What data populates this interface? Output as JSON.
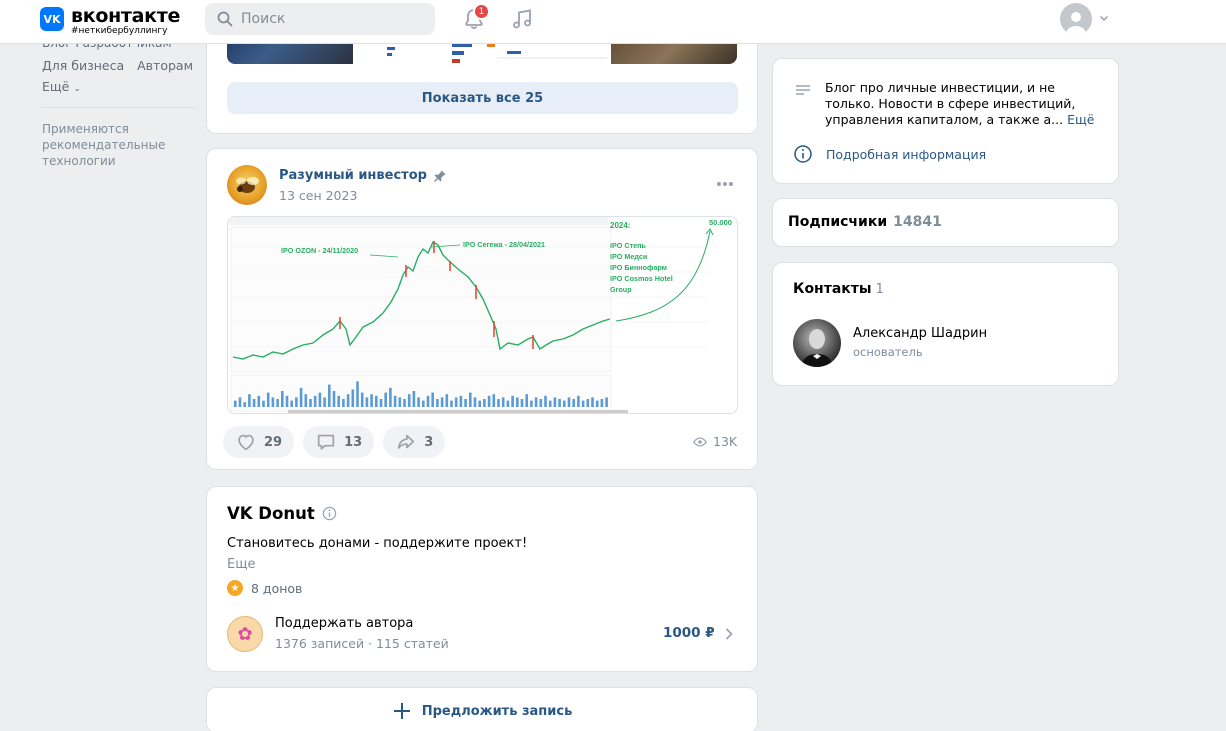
{
  "header": {
    "logo_title": "вконтакте",
    "logo_tag": "#неткибербуллингу",
    "logo_mark": "VK",
    "search_placeholder": "Поиск",
    "notifications_count": "1"
  },
  "leftnav": {
    "row1": "Блог   Разработчикам",
    "items": [
      "Для бизнеса",
      "Авторам"
    ],
    "more": "Ещё",
    "note": "Применяются рекомендательные технологии"
  },
  "photos": {
    "show_all": "Показать все 25"
  },
  "post": {
    "author": "Разумный инвестор",
    "date": "13 сен 2023",
    "chart_labels": {
      "ipo1": "IPO OZON - 24/11/2020",
      "ipo2": "IPO Сегежа - 28/04/2021",
      "year": "2024:",
      "target": "50.000",
      "list": [
        "IPO Степь",
        "IPO Медси",
        "IPO Биннофарм",
        "IPO Cosmos Hotel",
        "Group"
      ]
    },
    "likes": "29",
    "comments": "13",
    "shares": "3",
    "views": "13K"
  },
  "donut": {
    "title": "VK Donut",
    "description": "Становитесь донами - поддержите проект!",
    "more": "Еще",
    "donors": "8 донов",
    "support_title": "Поддержать автора",
    "support_sub": "1376 записей · 115 статей",
    "price": "1000 ₽"
  },
  "suggest": {
    "label": "Предложить запись"
  },
  "about": {
    "text": "Блог про личные инвестиции, и не только. Новости в сфере инвестиций, управления капиталом, а также а...",
    "more_link": "Ещё",
    "info_link": "Подробная информация"
  },
  "subscribers": {
    "label": "Подписчики",
    "count": "14841"
  },
  "contacts": {
    "title": "Контакты",
    "count": "1",
    "name": "Александр Шадрин",
    "role": "основатель"
  },
  "colors": {
    "accent": "#2a5885",
    "brand": "#0077ff",
    "badge": "#e64646",
    "background": "#edeef0"
  }
}
